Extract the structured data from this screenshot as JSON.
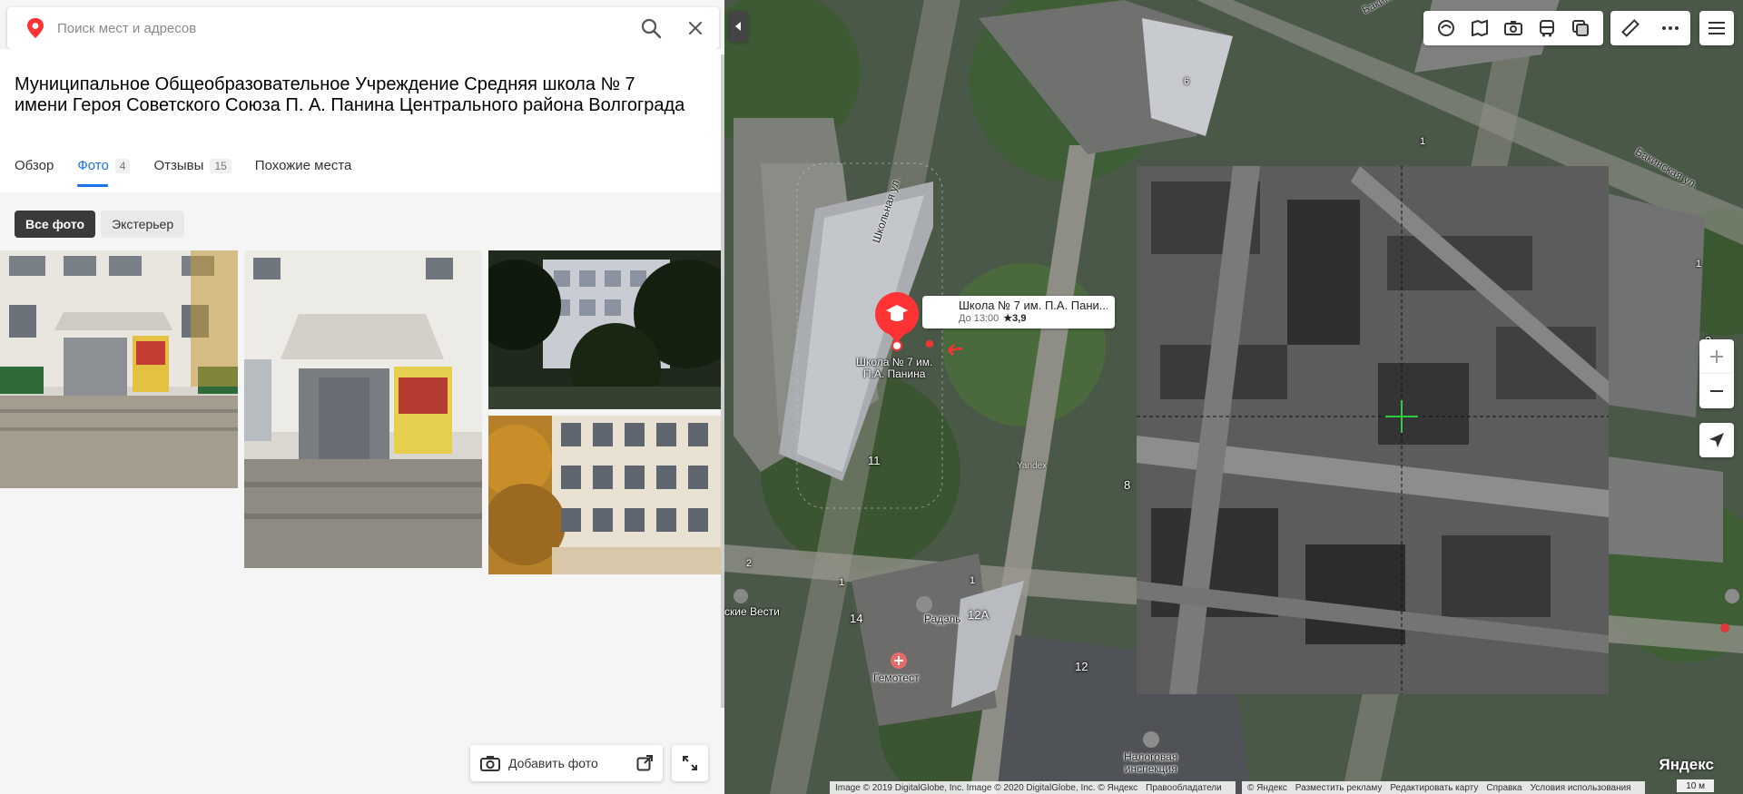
{
  "search": {
    "placeholder": "Поиск мест и адресов"
  },
  "org": {
    "title": "Муниципальное Общеобразовательное Учреждение Средняя школа № 7 имени Героя Советского Союза П. А. Панина Центрального района Волгограда"
  },
  "tabs": [
    {
      "label": "Обзор",
      "count": ""
    },
    {
      "label": "Фото",
      "count": "4",
      "active": true
    },
    {
      "label": "Отзывы",
      "count": "15"
    },
    {
      "label": "Похожие места",
      "count": ""
    }
  ],
  "filters": [
    {
      "label": "Все фото",
      "active": true
    },
    {
      "label": "Экстерьер",
      "active": false
    }
  ],
  "panel_actions": {
    "add_photo": "Добавить фото"
  },
  "map": {
    "poi": {
      "name": "Школа № 7 им. П.А. Пани...",
      "hours": "До 13:00",
      "rating": "★3,9",
      "pin_label_line1": "Школа № 7 им.",
      "pin_label_line2": "П.А. Панина"
    },
    "streets": {
      "shkolnaya": "Школьная ул.",
      "bakinskaya_top": "Бакинская ул.",
      "bakinskaya_right": "Бакинская ул."
    },
    "labels": {
      "radel": "Радэль",
      "gemotest": "Гемотест",
      "nalog_line1": "Налоговая",
      "nalog_line2": "инспекция",
      "vesti": "ские Вести",
      "yandex_watermark": "Yandex"
    },
    "building_numbers": [
      "11",
      "8",
      "14",
      "12А",
      "12",
      "2",
      "5",
      "6",
      "1",
      "1",
      "1",
      "1",
      "2"
    ],
    "attribution_left": [
      "Image © 2019 DigitalGlobe, Inc. Image © 2020 DigitalGlobe, Inc. © Яндекс",
      "Правообладатели"
    ],
    "attribution_right": [
      "© Яндекс",
      "Разместить рекламу",
      "Редактировать карту",
      "Справка",
      "Условия использования"
    ],
    "logo": "Яндекс",
    "scale": "10 м"
  },
  "colors": {
    "accent": "#1a73e8",
    "pin_red": "#f33",
    "crosshair": "#2ecc40"
  }
}
